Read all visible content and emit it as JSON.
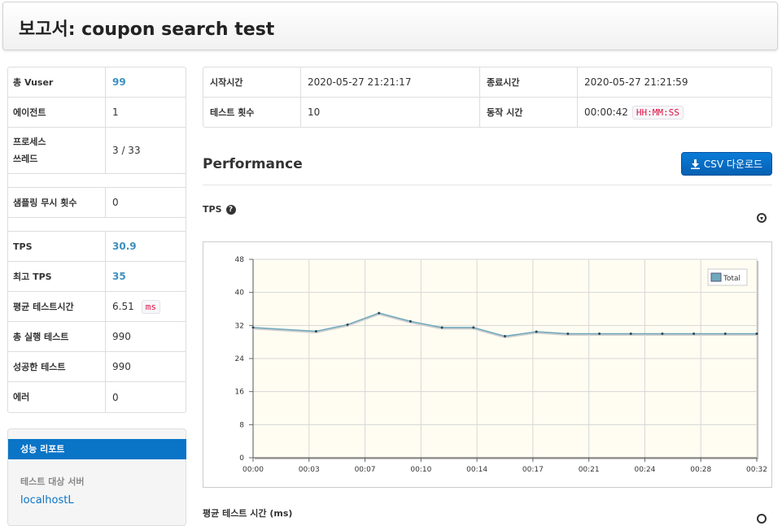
{
  "header": {
    "title": "보고서: coupon search test"
  },
  "summary": {
    "vuser_label": "총 Vuser",
    "vuser_value": "99",
    "agent_label": "에이전트",
    "agent_value": "1",
    "process_label_1": "프로세스",
    "process_label_2": "쓰레드",
    "process_value": "3 / 33",
    "ignore_label": "샘플링 무시 횟수",
    "ignore_value": "0",
    "tps_label": "TPS",
    "tps_value": "30.9",
    "peak_tps_label": "최고 TPS",
    "peak_tps_value": "35",
    "mtt_label": "평균 테스트시간",
    "mtt_value": "6.51",
    "mtt_unit": "ms",
    "total_label": "총 실행 테스트",
    "total_value": "990",
    "success_label": "성공한 테스트",
    "success_value": "990",
    "error_label": "에러",
    "error_value": "0"
  },
  "menu": {
    "active_item": "성능 리포트",
    "target_header": "테스트 대상 서버",
    "server": "localhostL"
  },
  "info": {
    "start_label": "시작시간",
    "start_value": "2020-05-27 21:21:17",
    "end_label": "종료시간",
    "end_value": "2020-05-27 21:21:59",
    "count_label": "테스트 횟수",
    "count_value": "10",
    "run_label": "동작 시간",
    "run_value": "00:00:42",
    "run_format": "HH:MM:SS"
  },
  "performance": {
    "title": "Performance",
    "csv_button": "CSV 다운로드",
    "tps_title": "TPS",
    "next_title": "평균 테스트 시간 (ms)"
  },
  "colors": {
    "accent": "#0a74c7",
    "series": "#6fa8be",
    "plot_bg": "#fffdf2"
  },
  "icons": {
    "help": "question-circle-icon",
    "download": "download-icon",
    "csv": "download-arrow-icon"
  },
  "chart_data": {
    "type": "line",
    "ylim": [
      0,
      48
    ],
    "yticks": [
      "0",
      "8",
      "16",
      "24",
      "32",
      "40",
      "48"
    ],
    "xticks": [
      "00:00",
      "00:03",
      "00:07",
      "00:10",
      "00:14",
      "00:17",
      "00:21",
      "00:24",
      "00:28",
      "00:32"
    ],
    "x_seconds": [
      0,
      4,
      6,
      8,
      10,
      12,
      14,
      16,
      18,
      20,
      22,
      24,
      26,
      28,
      30,
      32
    ],
    "grid": true,
    "legend_position": "top-right",
    "series": [
      {
        "name": "Total",
        "values": [
          31.5,
          30.6,
          32.2,
          35.0,
          33.0,
          31.5,
          31.5,
          29.4,
          30.5,
          30.0,
          30.0,
          30.0,
          30.0,
          30.0,
          30.0,
          30.0
        ]
      }
    ]
  }
}
